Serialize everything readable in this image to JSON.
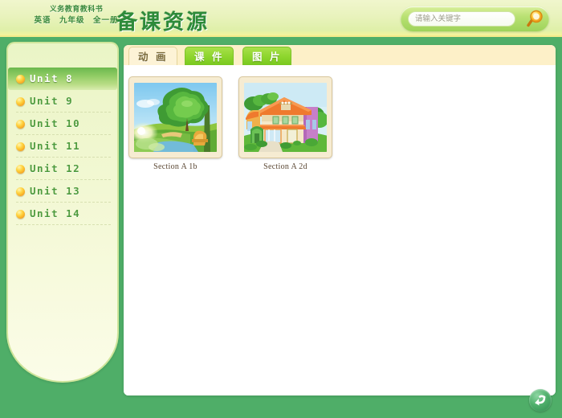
{
  "header": {
    "subtitle_line1": "义务教育教科书",
    "subtitle_line2": "英语　九年级　全一册",
    "title": "备课资源"
  },
  "search": {
    "placeholder": "请输入关键字",
    "value": "",
    "button_icon": "search-icon"
  },
  "sidebar": {
    "items": [
      {
        "label": "Unit 8",
        "active": true
      },
      {
        "label": "Unit 9",
        "active": false
      },
      {
        "label": "Unit 10",
        "active": false
      },
      {
        "label": "Unit 11",
        "active": false
      },
      {
        "label": "Unit 12",
        "active": false
      },
      {
        "label": "Unit 13",
        "active": false
      },
      {
        "label": "Unit 14",
        "active": false
      }
    ]
  },
  "tabs": [
    {
      "label": "动 画",
      "active": true
    },
    {
      "label": "课 件",
      "active": false
    },
    {
      "label": "图 片",
      "active": false
    }
  ],
  "resources": [
    {
      "label": "Section A 1b",
      "thumb": "nature-scene"
    },
    {
      "label": "Section A 2d",
      "thumb": "house-scene"
    }
  ],
  "footer": {
    "back_button_icon": "return-arrow-icon"
  },
  "colors": {
    "page_green": "#4fae68",
    "header_green_text": "#2e8b3a",
    "tab_green": "#8ed62e",
    "tab_active_cream": "#fdf3d6",
    "sidebar_cream": "#f0f7cf",
    "bullet_orange": "#f5a623",
    "label_brown": "#5a4632"
  }
}
